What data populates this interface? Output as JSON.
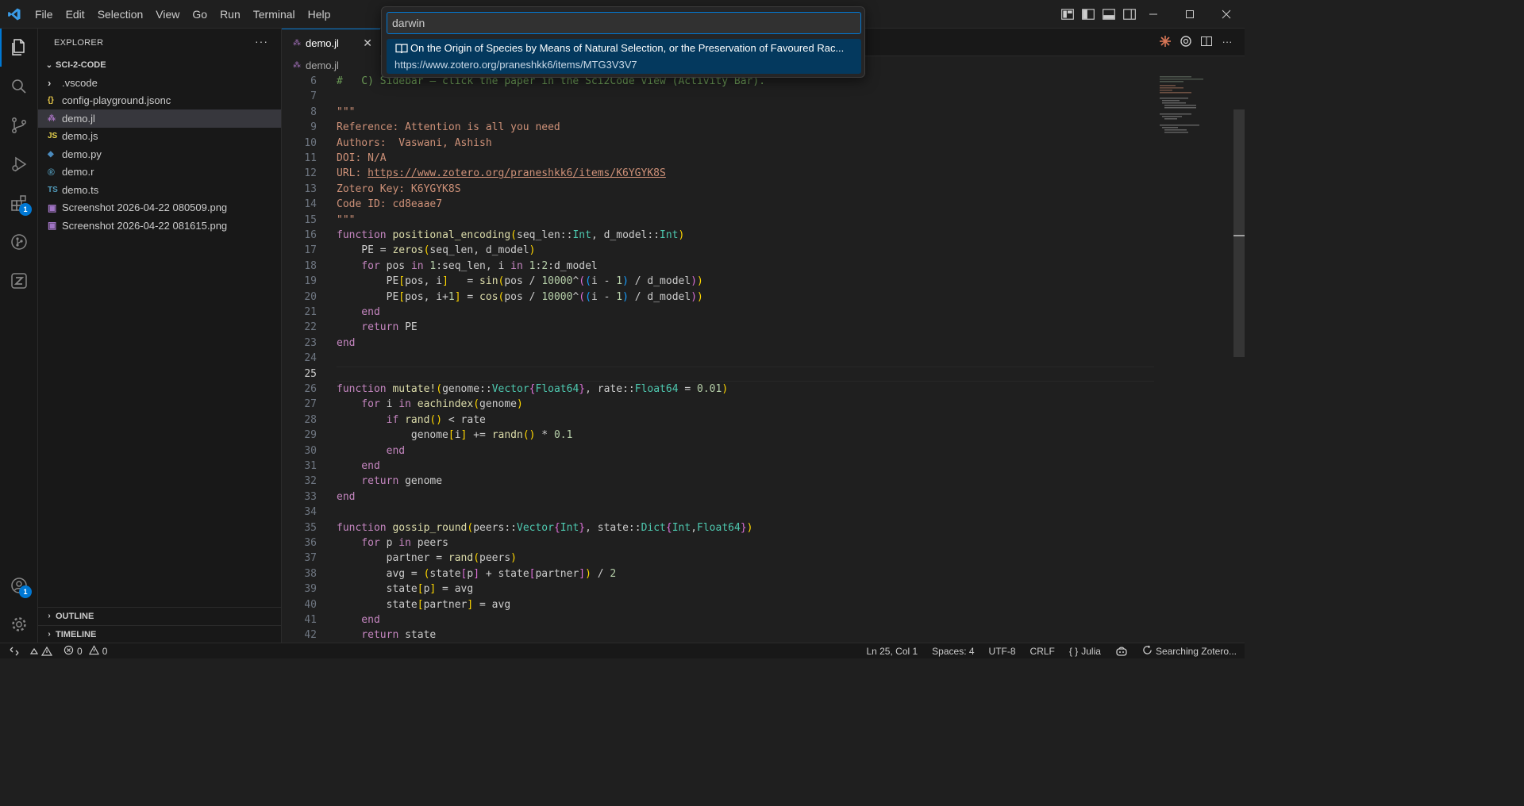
{
  "menu": [
    "File",
    "Edit",
    "Selection",
    "View",
    "Go",
    "Run",
    "Terminal",
    "Help"
  ],
  "activity_badges": {
    "extensions": "1",
    "accounts": "1"
  },
  "sidebar": {
    "title": "EXPLORER",
    "more": "···",
    "folder": "SCI-2-CODE",
    "items": [
      {
        "label": ".vscode",
        "icon": "›",
        "kind": "folder"
      },
      {
        "label": "config-playground.jsonc",
        "icon": "{}",
        "kind": "json"
      },
      {
        "label": "demo.jl",
        "icon": "⁂",
        "kind": "julia"
      },
      {
        "label": "demo.js",
        "icon": "JS",
        "kind": "js"
      },
      {
        "label": "demo.py",
        "icon": "◆",
        "kind": "python"
      },
      {
        "label": "demo.r",
        "icon": "®",
        "kind": "r"
      },
      {
        "label": "demo.ts",
        "icon": "TS",
        "kind": "ts"
      },
      {
        "label": "Screenshot 2026-04-22 080509.png",
        "icon": "▣",
        "kind": "image"
      },
      {
        "label": "Screenshot 2026-04-22 081615.png",
        "icon": "▣",
        "kind": "image"
      }
    ],
    "outline": "OUTLINE",
    "timeline": "TIMELINE"
  },
  "tab": {
    "label": "demo.jl",
    "close": "✕"
  },
  "breadcrumb": "demo.jl",
  "quickpick": {
    "value": "darwin",
    "item_title": "On the Origin of Species by Means of Natural Selection, or the Preservation of Favoured Rac...",
    "item_url": "https://www.zotero.org/praneshkk6/items/MTG3V3V7"
  },
  "code": {
    "first_line": 6,
    "current_line": 25,
    "lines": [
      [
        [
          "cm",
          "#   C) Sidebar — click the paper in the Sci2Code view (Activity Bar)."
        ]
      ],
      [],
      [
        [
          "str",
          "\"\"\""
        ]
      ],
      [
        [
          "str",
          "Reference: Attention is all you need"
        ]
      ],
      [
        [
          "str",
          "Authors:  Vaswani, Ashish"
        ]
      ],
      [
        [
          "str",
          "DOI: N/A"
        ]
      ],
      [
        [
          "str",
          "URL: "
        ],
        [
          "link",
          "https://www.zotero.org/praneshkk6/items/K6YGYK8S"
        ]
      ],
      [
        [
          "str",
          "Zotero Key: K6YGYK8S"
        ]
      ],
      [
        [
          "str",
          "Code ID: cd8eaae7"
        ]
      ],
      [
        [
          "str",
          "\"\"\""
        ]
      ],
      [
        [
          "kw",
          "function "
        ],
        [
          "fn",
          "positional_encoding"
        ],
        [
          "b1",
          "("
        ],
        [
          "",
          "seq_len::"
        ],
        [
          "ty",
          "Int"
        ],
        [
          "",
          ", d_model::"
        ],
        [
          "ty",
          "Int"
        ],
        [
          "b1",
          ")"
        ]
      ],
      [
        [
          "",
          "    PE = "
        ],
        [
          "fn",
          "zeros"
        ],
        [
          "b1",
          "("
        ],
        [
          "",
          "seq_len, d_model"
        ],
        [
          "b1",
          ")"
        ]
      ],
      [
        [
          "kw",
          "    for "
        ],
        [
          "",
          "pos "
        ],
        [
          "kw",
          "in "
        ],
        [
          "num",
          "1"
        ],
        [
          "",
          ":seq_len, i "
        ],
        [
          "kw",
          "in "
        ],
        [
          "num",
          "1"
        ],
        [
          "",
          ":"
        ],
        [
          "num",
          "2"
        ],
        [
          "",
          ":d_model"
        ]
      ],
      [
        [
          "",
          "        PE"
        ],
        [
          "b1",
          "["
        ],
        [
          "",
          "pos, i"
        ],
        [
          "b1",
          "]"
        ],
        [
          "",
          "   = "
        ],
        [
          "fn",
          "sin"
        ],
        [
          "b1",
          "("
        ],
        [
          "",
          "pos / "
        ],
        [
          "num",
          "10000"
        ],
        [
          "",
          "^"
        ],
        [
          "b2",
          "("
        ],
        [
          "b3",
          "("
        ],
        [
          "",
          "i - "
        ],
        [
          "num",
          "1"
        ],
        [
          "b3",
          ")"
        ],
        [
          "",
          " / d_model"
        ],
        [
          "b2",
          ")"
        ],
        [
          "b1",
          ")"
        ]
      ],
      [
        [
          "",
          "        PE"
        ],
        [
          "b1",
          "["
        ],
        [
          "",
          "pos, i+"
        ],
        [
          "num",
          "1"
        ],
        [
          "b1",
          "]"
        ],
        [
          "",
          " = "
        ],
        [
          "fn",
          "cos"
        ],
        [
          "b1",
          "("
        ],
        [
          "",
          "pos / "
        ],
        [
          "num",
          "10000"
        ],
        [
          "",
          "^"
        ],
        [
          "b2",
          "("
        ],
        [
          "b3",
          "("
        ],
        [
          "",
          "i - "
        ],
        [
          "num",
          "1"
        ],
        [
          "b3",
          ")"
        ],
        [
          "",
          " / d_model"
        ],
        [
          "b2",
          ")"
        ],
        [
          "b1",
          ")"
        ]
      ],
      [
        [
          "kw",
          "    end"
        ]
      ],
      [
        [
          "kw",
          "    return "
        ],
        [
          "",
          "PE"
        ]
      ],
      [
        [
          "kw",
          "end"
        ]
      ],
      [],
      [],
      [
        [
          "kw",
          "function "
        ],
        [
          "fn",
          "mutate!"
        ],
        [
          "b1",
          "("
        ],
        [
          "",
          "genome::"
        ],
        [
          "ty",
          "Vector"
        ],
        [
          "b2",
          "{"
        ],
        [
          "ty",
          "Float64"
        ],
        [
          "b2",
          "}"
        ],
        [
          "",
          ", rate::"
        ],
        [
          "ty",
          "Float64"
        ],
        [
          "",
          " = "
        ],
        [
          "num",
          "0.01"
        ],
        [
          "b1",
          ")"
        ]
      ],
      [
        [
          "kw",
          "    for "
        ],
        [
          "",
          "i "
        ],
        [
          "kw",
          "in "
        ],
        [
          "fn",
          "eachindex"
        ],
        [
          "b1",
          "("
        ],
        [
          "",
          "genome"
        ],
        [
          "b1",
          ")"
        ]
      ],
      [
        [
          "kw",
          "        if "
        ],
        [
          "fn",
          "rand"
        ],
        [
          "b1",
          "()"
        ],
        [
          "",
          " < rate"
        ]
      ],
      [
        [
          "",
          "            genome"
        ],
        [
          "b1",
          "["
        ],
        [
          "",
          "i"
        ],
        [
          "b1",
          "]"
        ],
        [
          "",
          " += "
        ],
        [
          "fn",
          "randn"
        ],
        [
          "b1",
          "()"
        ],
        [
          "",
          " * "
        ],
        [
          "num",
          "0.1"
        ]
      ],
      [
        [
          "kw",
          "        end"
        ]
      ],
      [
        [
          "kw",
          "    end"
        ]
      ],
      [
        [
          "kw",
          "    return "
        ],
        [
          "",
          "genome"
        ]
      ],
      [
        [
          "kw",
          "end"
        ]
      ],
      [],
      [
        [
          "kw",
          "function "
        ],
        [
          "fn",
          "gossip_round"
        ],
        [
          "b1",
          "("
        ],
        [
          "",
          "peers::"
        ],
        [
          "ty",
          "Vector"
        ],
        [
          "b2",
          "{"
        ],
        [
          "ty",
          "Int"
        ],
        [
          "b2",
          "}"
        ],
        [
          "",
          ", state::"
        ],
        [
          "ty",
          "Dict"
        ],
        [
          "b2",
          "{"
        ],
        [
          "ty",
          "Int"
        ],
        [
          "",
          ","
        ],
        [
          "ty",
          "Float64"
        ],
        [
          "b2",
          "}"
        ],
        [
          "b1",
          ")"
        ]
      ],
      [
        [
          "kw",
          "    for "
        ],
        [
          "",
          "p "
        ],
        [
          "kw",
          "in "
        ],
        [
          "",
          "peers"
        ]
      ],
      [
        [
          "",
          "        partner = "
        ],
        [
          "fn",
          "rand"
        ],
        [
          "b1",
          "("
        ],
        [
          "",
          "peers"
        ],
        [
          "b1",
          ")"
        ]
      ],
      [
        [
          "",
          "        avg = "
        ],
        [
          "b1",
          "("
        ],
        [
          "",
          "state"
        ],
        [
          "b2",
          "["
        ],
        [
          "",
          "p"
        ],
        [
          "b2",
          "]"
        ],
        [
          "",
          " + state"
        ],
        [
          "b2",
          "["
        ],
        [
          "",
          "partner"
        ],
        [
          "b2",
          "]"
        ],
        [
          "b1",
          ")"
        ],
        [
          "",
          " / "
        ],
        [
          "num",
          "2"
        ]
      ],
      [
        [
          "",
          "        state"
        ],
        [
          "b1",
          "["
        ],
        [
          "",
          "p"
        ],
        [
          "b1",
          "]"
        ],
        [
          "",
          " = avg"
        ]
      ],
      [
        [
          "",
          "        state"
        ],
        [
          "b1",
          "["
        ],
        [
          "",
          "partner"
        ],
        [
          "b1",
          "]"
        ],
        [
          "",
          " = avg"
        ]
      ],
      [
        [
          "kw",
          "    end"
        ]
      ],
      [
        [
          "kw",
          "    return "
        ],
        [
          "",
          "state"
        ]
      ]
    ]
  },
  "status": {
    "problems_errors": "0",
    "problems_warnings": "0",
    "position": "Ln 25, Col 1",
    "spaces": "Spaces: 4",
    "encoding": "UTF-8",
    "eol": "CRLF",
    "language": "Julia",
    "language_braces": "{ }",
    "searching": "Searching Zotero..."
  },
  "colors": {
    "accent": "#0078d4",
    "selection": "#04395e",
    "editor_bg": "#1f1f1f",
    "sidebar_bg": "#181818"
  }
}
